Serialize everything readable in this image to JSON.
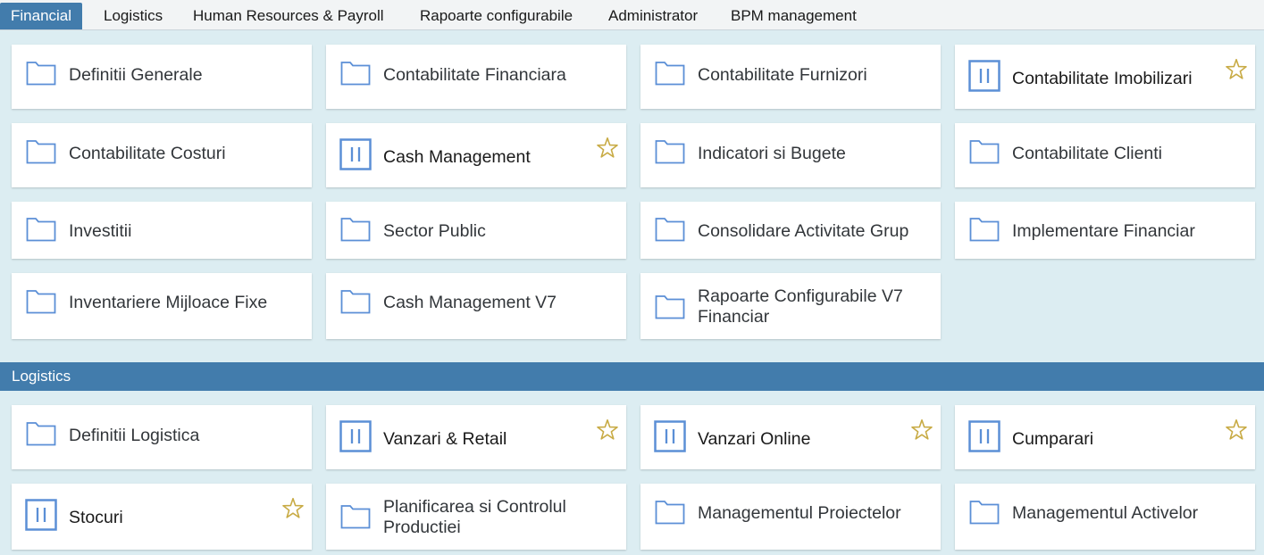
{
  "tabs": [
    {
      "label": "Financial",
      "active": true
    },
    {
      "label": "Logistics",
      "active": false
    },
    {
      "label": "Human Resources & Payroll",
      "active": false
    },
    {
      "label": "Rapoarte configurabile",
      "active": false
    },
    {
      "label": "Administrator",
      "active": false
    },
    {
      "label": "BPM management",
      "active": false
    }
  ],
  "colors": {
    "accent": "#427cac",
    "background": "#dcedf2",
    "icon_blue": "#5b8fd6",
    "star_gold": "#c8ab45"
  },
  "financial": {
    "tiles": [
      {
        "label": "Definitii Generale",
        "icon": "folder-icon"
      },
      {
        "label": "Contabilitate Financiara",
        "icon": "folder-icon"
      },
      {
        "label": "Contabilitate Furnizori",
        "icon": "folder-icon"
      },
      {
        "label": "Contabilitate Imobilizari",
        "icon": "app-icon",
        "favorite": true
      },
      {
        "label": "Contabilitate Costuri",
        "icon": "folder-icon"
      },
      {
        "label": "Cash Management",
        "icon": "app-icon",
        "favorite": true
      },
      {
        "label": "Indicatori si Bugete",
        "icon": "folder-icon"
      },
      {
        "label": "Contabilitate Clienti",
        "icon": "folder-icon"
      },
      {
        "label": "Investitii",
        "icon": "folder-icon"
      },
      {
        "label": "Sector Public",
        "icon": "folder-icon"
      },
      {
        "label": "Consolidare Activitate Grup",
        "icon": "folder-icon"
      },
      {
        "label": "Implementare Financiar",
        "icon": "folder-icon"
      },
      {
        "label": "Inventariere Mijloace Fixe",
        "icon": "folder-icon"
      },
      {
        "label": "Cash Management V7",
        "icon": "folder-icon"
      },
      {
        "label": "Rapoarte Configurabile V7 Financiar",
        "icon": "folder-icon"
      }
    ]
  },
  "logistics": {
    "title": "Logistics",
    "tiles": [
      {
        "label": "Definitii Logistica",
        "icon": "folder-icon"
      },
      {
        "label": "Vanzari & Retail",
        "icon": "app-icon",
        "favorite": true
      },
      {
        "label": "Vanzari Online",
        "icon": "app-icon",
        "favorite": true
      },
      {
        "label": "Cumparari",
        "icon": "app-icon",
        "favorite": true
      },
      {
        "label": "Stocuri",
        "icon": "app-icon",
        "favorite": true
      },
      {
        "label": "Planificarea si Controlul Productiei",
        "icon": "folder-icon"
      },
      {
        "label": "Managementul Proiectelor",
        "icon": "folder-icon"
      },
      {
        "label": "Managementul Activelor",
        "icon": "folder-icon"
      }
    ]
  }
}
